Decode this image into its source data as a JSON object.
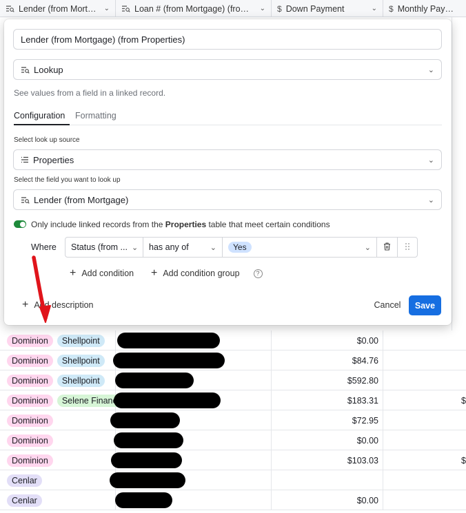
{
  "header": {
    "columns": [
      {
        "label": "Lender (from Mortga...",
        "icon": "lookup-icon"
      },
      {
        "label": "Loan # (from Mortgage) (from Pr...",
        "icon": "lookup-icon"
      },
      {
        "label": "Down Payment",
        "icon": "currency-icon"
      },
      {
        "label": "Monthly Payment",
        "icon": "currency-icon"
      }
    ]
  },
  "popup": {
    "field_name": "Lender (from Mortgage) (from Properties)",
    "field_type": "Lookup",
    "field_type_description": "See values from a field in a linked record.",
    "tabs": [
      "Configuration",
      "Formatting"
    ],
    "source_label": "Select look up source",
    "source_value": "Properties",
    "lookup_field_label": "Select the field you want to look up",
    "lookup_field_value": "Lender (from Mortgage)",
    "condition_toggle": {
      "on": true,
      "text_before": "Only include linked records from the ",
      "table": "Properties",
      "text_after": " table that meet certain conditions"
    },
    "condition": {
      "where_label": "Where",
      "field": "Status (from ...",
      "operator": "has any of",
      "value": "Yes"
    },
    "add_condition": "Add condition",
    "add_condition_group": "Add condition group",
    "add_description": "Add description",
    "cancel": "Cancel",
    "save": "Save"
  },
  "rows": [
    {
      "lenders": [
        {
          "name": "Dominion",
          "color": "pink"
        },
        {
          "name": "Shellpoint",
          "color": "blue"
        }
      ],
      "down_payment": "$0.00",
      "monthly": ""
    },
    {
      "lenders": [
        {
          "name": "Dominion",
          "color": "pink"
        },
        {
          "name": "Shellpoint",
          "color": "blue"
        }
      ],
      "down_payment": "$84.76",
      "monthly": ""
    },
    {
      "lenders": [
        {
          "name": "Dominion",
          "color": "pink"
        },
        {
          "name": "Shellpoint",
          "color": "blue"
        }
      ],
      "down_payment": "$592.80",
      "monthly": ""
    },
    {
      "lenders": [
        {
          "name": "Dominion",
          "color": "pink"
        },
        {
          "name": "Selene Finance",
          "color": "green"
        }
      ],
      "down_payment": "$183.31",
      "monthly": "$"
    },
    {
      "lenders": [
        {
          "name": "Dominion",
          "color": "pink"
        }
      ],
      "down_payment": "$72.95",
      "monthly": ""
    },
    {
      "lenders": [
        {
          "name": "Dominion",
          "color": "pink"
        }
      ],
      "down_payment": "$0.00",
      "monthly": ""
    },
    {
      "lenders": [
        {
          "name": "Dominion",
          "color": "pink"
        }
      ],
      "down_payment": "$103.03",
      "monthly": "$"
    },
    {
      "lenders": [
        {
          "name": "Cenlar",
          "color": "purple"
        }
      ],
      "down_payment": "",
      "monthly": ""
    },
    {
      "lenders": [
        {
          "name": "Cenlar",
          "color": "purple"
        }
      ],
      "down_payment": "$0.00",
      "monthly": ""
    }
  ],
  "colors": {
    "save_button": "#166ee1",
    "toggle_on": "#1e8a3b",
    "annotation_arrow": "#e0141b",
    "pill_pink": "#ffd6ee",
    "pill_blue": "#cfe9f7",
    "pill_green": "#d6f5d6",
    "pill_purple": "#e2def7"
  }
}
